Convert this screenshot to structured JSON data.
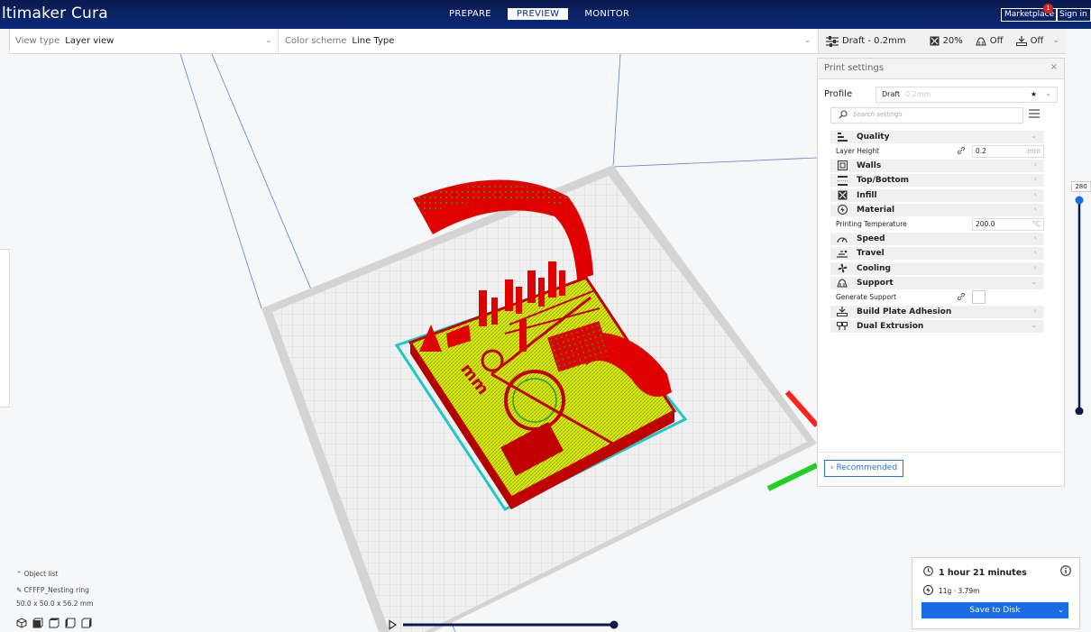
{
  "header": {
    "app_title": "ltimaker Cura",
    "stages": [
      "PREPARE",
      "PREVIEW",
      "MONITOR"
    ],
    "active_stage": "PREVIEW",
    "marketplace": "Marketplace",
    "marketplace_badge": "1",
    "sign_in": "Sign in"
  },
  "toolbar": {
    "view_type_label": "View type",
    "view_type_value": "Layer view",
    "color_scheme_label": "Color scheme",
    "color_scheme_value": "Line Type",
    "profile_summary": "Draft - 0.2mm",
    "infill": "20%",
    "support": "Off",
    "adhesion": "Off"
  },
  "print_settings": {
    "title": "Print settings",
    "close": "×",
    "profile_label": "Profile",
    "profile_value": "Draft",
    "profile_sub": "0.2mm",
    "search_placeholder": "Search settings",
    "categories": [
      {
        "label": "Quality",
        "icon": "quality-icon",
        "chev": "⌄"
      },
      {
        "label": "Walls",
        "icon": "walls-icon",
        "chev": "‹"
      },
      {
        "label": "Top/Bottom",
        "icon": "top-bottom-icon",
        "chev": "‹"
      },
      {
        "label": "Infill",
        "icon": "infill-icon",
        "chev": "‹"
      },
      {
        "label": "Material",
        "icon": "material-icon",
        "chev": "‹"
      },
      {
        "label": "Speed",
        "icon": "speed-icon",
        "chev": "‹"
      },
      {
        "label": "Travel",
        "icon": "travel-icon",
        "chev": "‹"
      },
      {
        "label": "Cooling",
        "icon": "cooling-icon",
        "chev": "‹"
      },
      {
        "label": "Support",
        "icon": "support-icon",
        "chev": "⌄"
      },
      {
        "label": "Build Plate Adhesion",
        "icon": "adhesion-icon",
        "chev": "‹"
      },
      {
        "label": "Dual Extrusion",
        "icon": "dual-extrusion-icon",
        "chev": "⌄"
      }
    ],
    "layer_height_label": "Layer Height",
    "layer_height_value": "0.2",
    "layer_height_unit": "mm",
    "printing_temp_label": "Printing Temperature",
    "printing_temp_value": "200.0",
    "printing_temp_unit": "°C",
    "generate_support_label": "Generate Support",
    "recommended_button": "Recommended"
  },
  "layer_slider": {
    "top_value": "280"
  },
  "object_list": {
    "title": "Object list",
    "object_name": "CFFFP_Nesting ring",
    "dimensions": "50.0 x 50.0 x 56.2 mm"
  },
  "print_info": {
    "time": "1 hour 21 minutes",
    "material": "11g · 3.79m",
    "save_button": "Save to Disk"
  }
}
